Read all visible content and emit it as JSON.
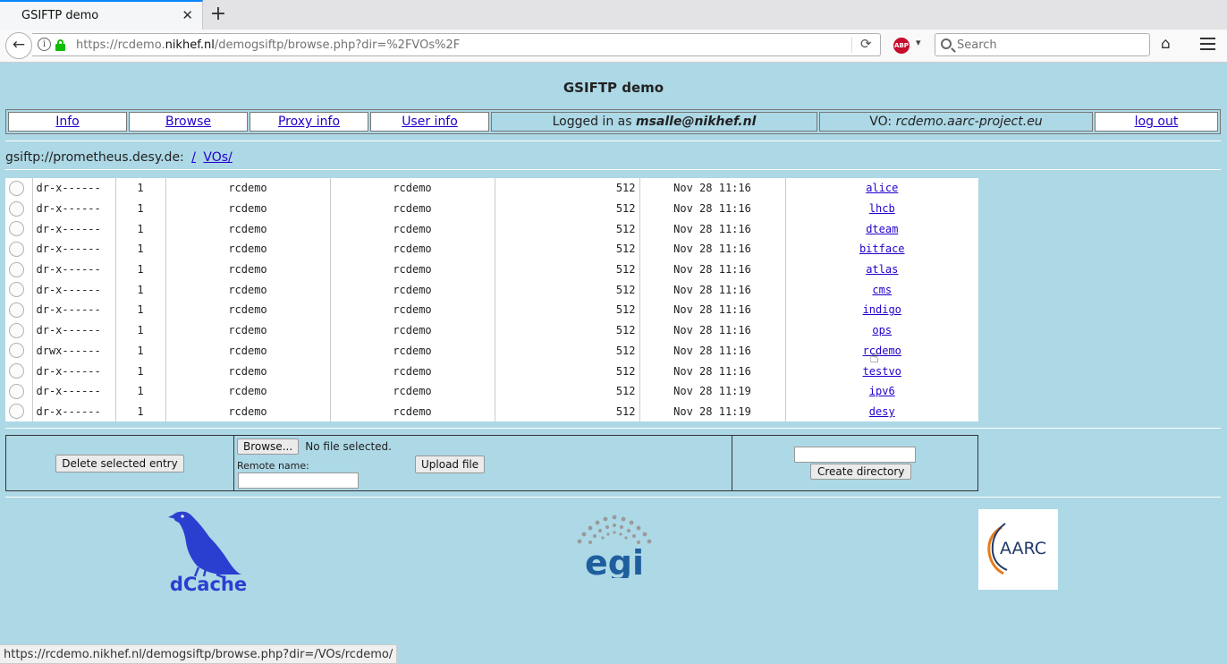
{
  "browser": {
    "tab_title": "GSIFTP demo",
    "url_prefix": "https://rcdemo.",
    "url_domain": "nikhef.nl",
    "url_suffix": "/demogsiftp/browse.php?dir=%2FVOs%2F",
    "search_placeholder": "Search",
    "abp_label": "ABP",
    "status_url": "https://rcdemo.nikhef.nl/demogsiftp/browse.php?dir=/VOs/rcdemo/"
  },
  "page": {
    "title": "GSIFTP demo",
    "nav": {
      "info": "Info",
      "browse": "Browse",
      "proxy_info": "Proxy info",
      "user_info": "User info",
      "logged_in_prefix": "Logged in as ",
      "logged_in_user": "msalle@nikhef.nl",
      "vo_prefix": "VO: ",
      "vo_name": "rcdemo.aarc-project.eu",
      "logout": "log out"
    },
    "path": {
      "host": "gsiftp://prometheus.desy.de:",
      "root": "/",
      "dir": "VOs/"
    }
  },
  "files": [
    {
      "perm": "dr-x------",
      "links": "1",
      "owner": "rcdemo",
      "group": "rcdemo",
      "size": "512",
      "date": "Nov 28 11:16",
      "name": "alice"
    },
    {
      "perm": "dr-x------",
      "links": "1",
      "owner": "rcdemo",
      "group": "rcdemo",
      "size": "512",
      "date": "Nov 28 11:16",
      "name": "lhcb"
    },
    {
      "perm": "dr-x------",
      "links": "1",
      "owner": "rcdemo",
      "group": "rcdemo",
      "size": "512",
      "date": "Nov 28 11:16",
      "name": "dteam"
    },
    {
      "perm": "dr-x------",
      "links": "1",
      "owner": "rcdemo",
      "group": "rcdemo",
      "size": "512",
      "date": "Nov 28 11:16",
      "name": "bitface"
    },
    {
      "perm": "dr-x------",
      "links": "1",
      "owner": "rcdemo",
      "group": "rcdemo",
      "size": "512",
      "date": "Nov 28 11:16",
      "name": "atlas"
    },
    {
      "perm": "dr-x------",
      "links": "1",
      "owner": "rcdemo",
      "group": "rcdemo",
      "size": "512",
      "date": "Nov 28 11:16",
      "name": "cms"
    },
    {
      "perm": "dr-x------",
      "links": "1",
      "owner": "rcdemo",
      "group": "rcdemo",
      "size": "512",
      "date": "Nov 28 11:16",
      "name": "indigo"
    },
    {
      "perm": "dr-x------",
      "links": "1",
      "owner": "rcdemo",
      "group": "rcdemo",
      "size": "512",
      "date": "Nov 28 11:16",
      "name": "ops"
    },
    {
      "perm": "drwx------",
      "links": "1",
      "owner": "rcdemo",
      "group": "rcdemo",
      "size": "512",
      "date": "Nov 28 11:16",
      "name": "rcdemo"
    },
    {
      "perm": "dr-x------",
      "links": "1",
      "owner": "rcdemo",
      "group": "rcdemo",
      "size": "512",
      "date": "Nov 28 11:16",
      "name": "testvo"
    },
    {
      "perm": "dr-x------",
      "links": "1",
      "owner": "rcdemo",
      "group": "rcdemo",
      "size": "512",
      "date": "Nov 28 11:19",
      "name": "ipv6"
    },
    {
      "perm": "dr-x------",
      "links": "1",
      "owner": "rcdemo",
      "group": "rcdemo",
      "size": "512",
      "date": "Nov 28 11:19",
      "name": "desy"
    }
  ],
  "actions": {
    "delete_label": "Delete selected entry",
    "browse_label": "Browse...",
    "no_file": "No file selected.",
    "remote_name_label": "Remote name:",
    "upload_label": "Upload file",
    "create_dir_label": "Create directory"
  },
  "logos": {
    "dcache": "dCache",
    "egi": "egi",
    "aarc": "AARC"
  }
}
